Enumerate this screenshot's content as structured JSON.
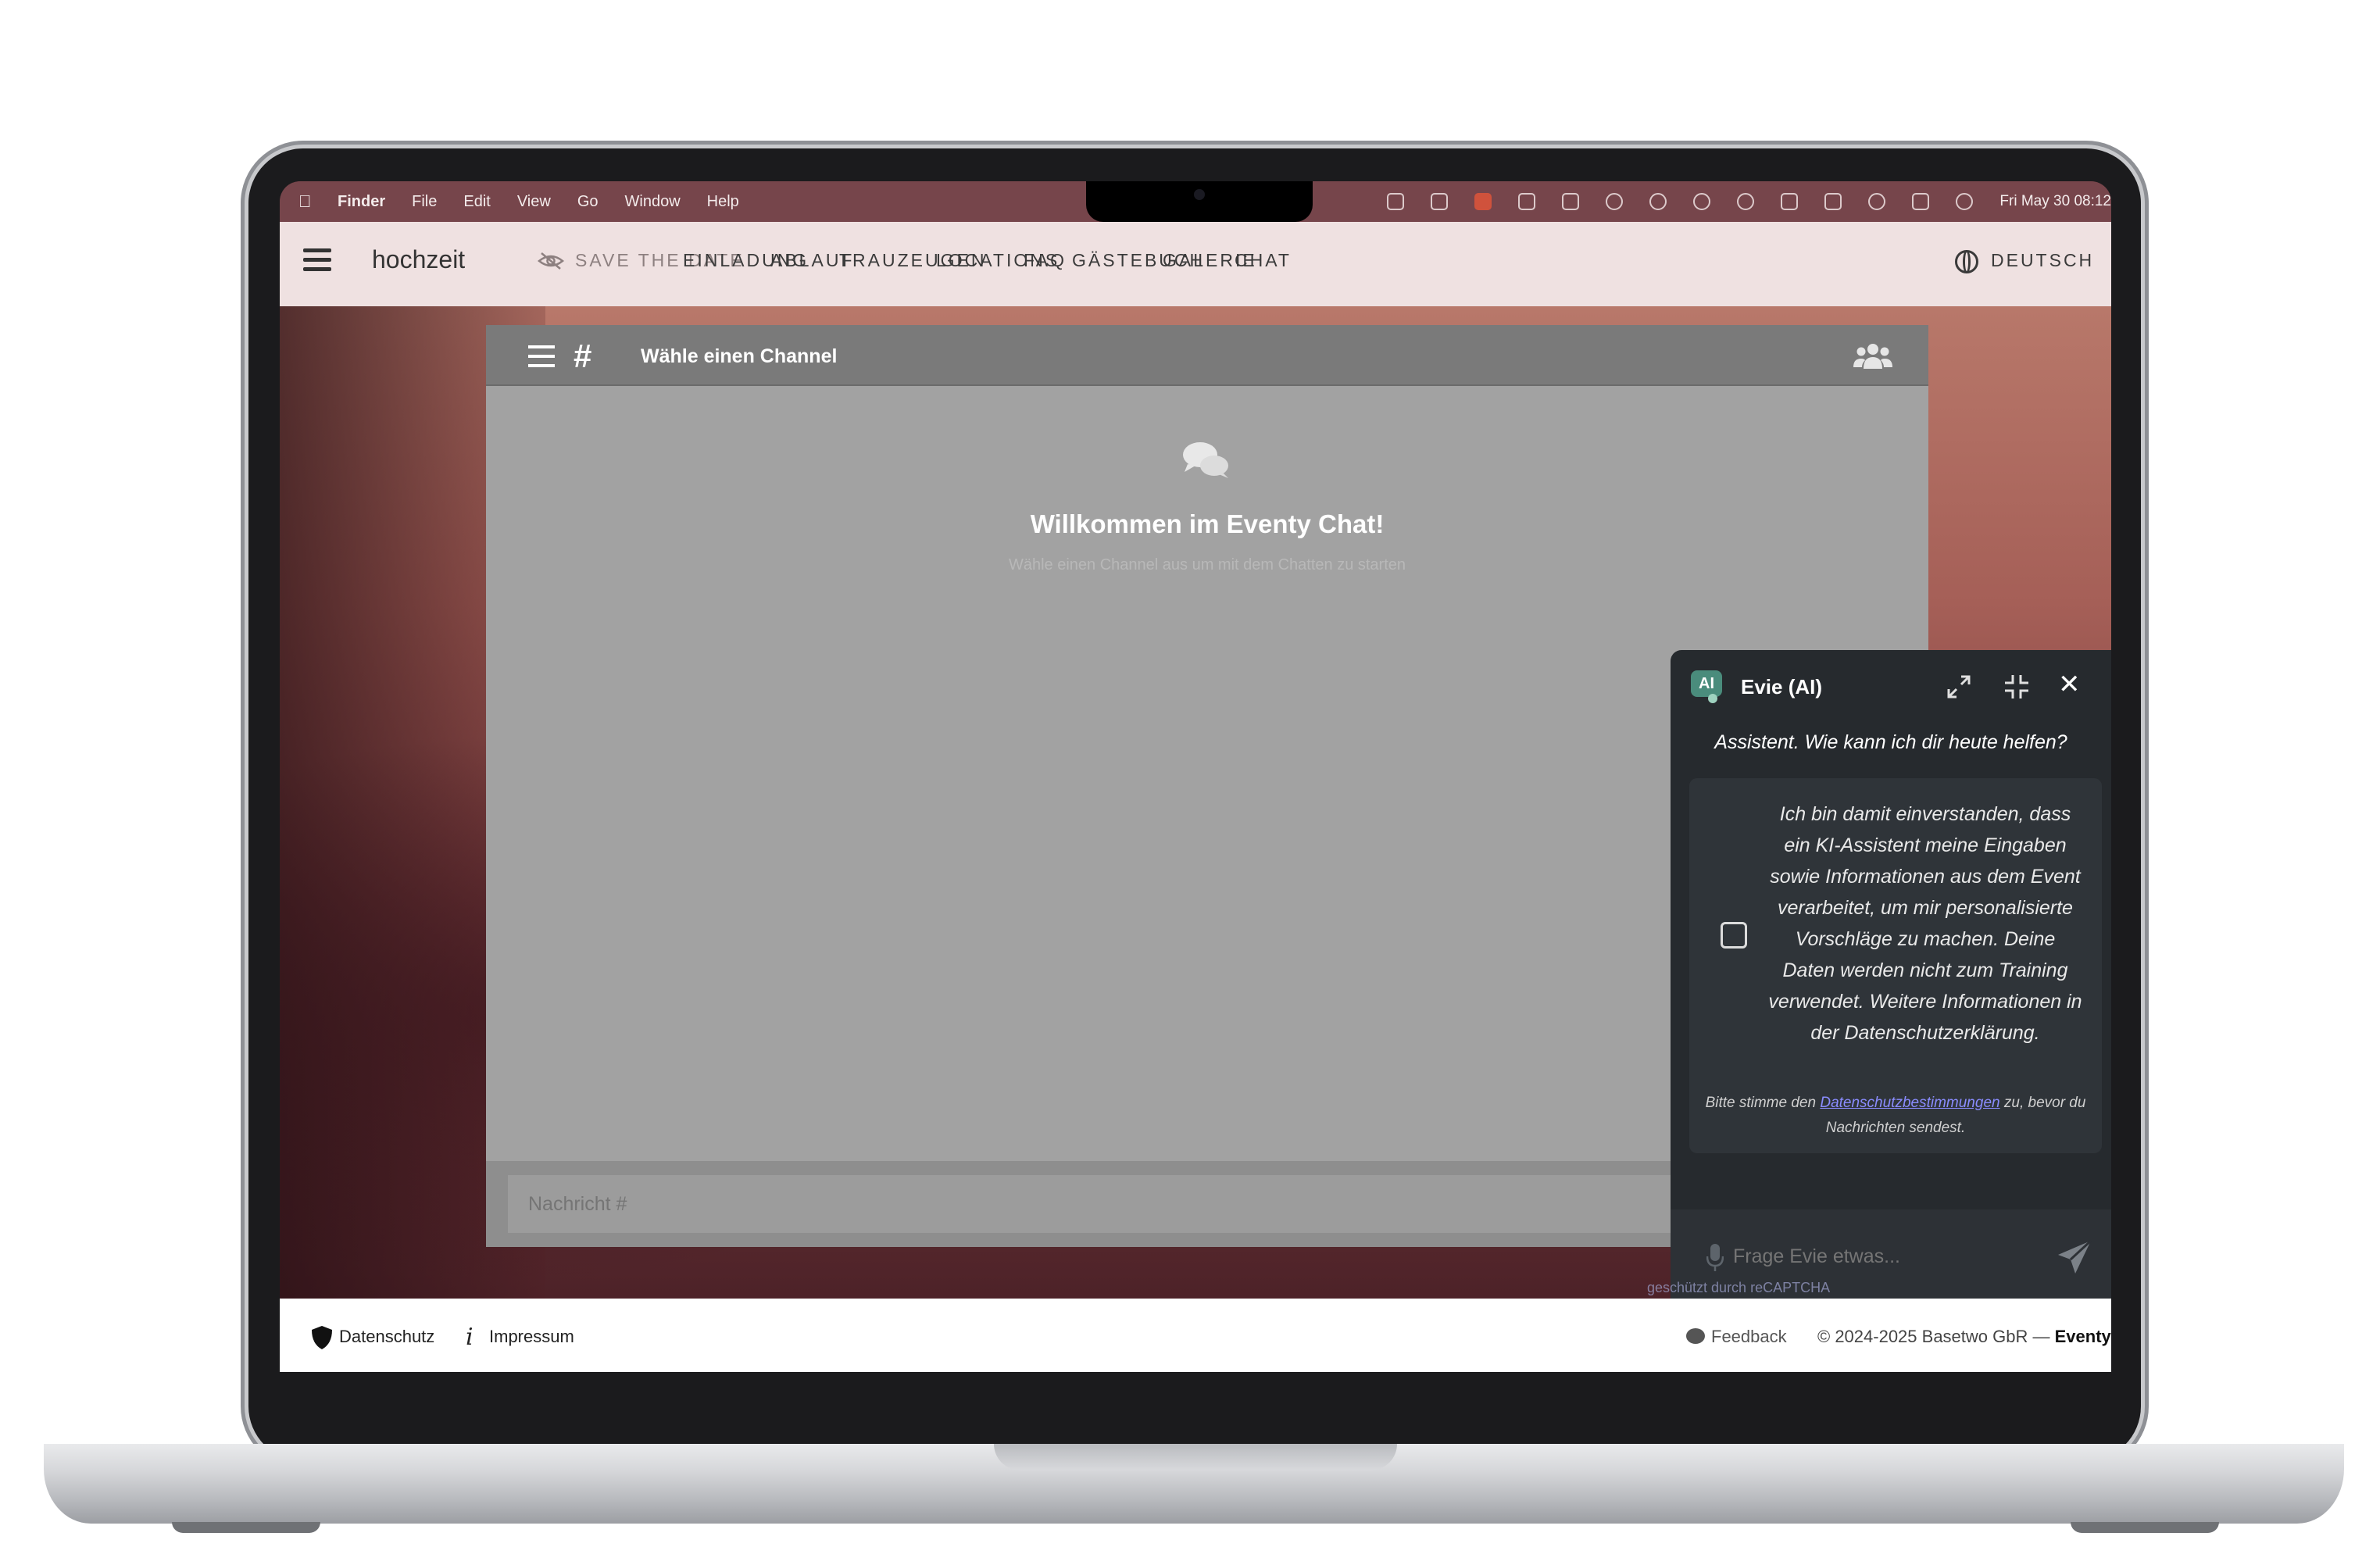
{
  "menubar": {
    "app": "Finder",
    "items": [
      "File",
      "Edit",
      "View",
      "Go",
      "Window",
      "Help"
    ],
    "clock": "Fri May 30  08:12"
  },
  "site": {
    "brand": "hochzeit",
    "nav": [
      {
        "label": "SAVE THE DATE",
        "muted": true
      },
      {
        "label": "EINLADUNG"
      },
      {
        "label": "ABLAUF"
      },
      {
        "label": "TRAUZEUGEN"
      },
      {
        "label": "LOCATIONS"
      },
      {
        "label": "FAQ"
      },
      {
        "label": "GÄSTEBUCH"
      },
      {
        "label": "GALERIE"
      },
      {
        "label": "CHAT"
      }
    ],
    "language": "DEUTSCH"
  },
  "chat": {
    "channel_title": "Wähle einen Channel",
    "welcome_title": "Willkommen im Eventy Chat!",
    "welcome_sub": "Wähle einen Channel aus um mit dem Chatten zu starten",
    "input_placeholder": "Nachricht #"
  },
  "ai": {
    "badge": "AI",
    "title": "Evie (AI)",
    "greeting": "Assistent. Wie kann ich dir heute helfen?",
    "consent_text": "Ich bin damit einverstanden, dass ein KI-Assistent meine Eingaben sowie Informationen aus dem Event verarbeitet, um mir personalisierte Vorschläge zu machen. Deine Daten werden nicht zum Training verwendet. Weitere Informationen in der Datenschutzerklärung.",
    "note_before": "Bitte stimme den ",
    "note_link": "Datenschutzbestimmungen",
    "note_after": " zu, bevor du Nachrichten sendest.",
    "input_placeholder": "Frage Evie etwas...",
    "recaptcha": "geschützt durch reCAPTCHA"
  },
  "footer": {
    "privacy": "Datenschutz",
    "imprint": "Impressum",
    "feedback": "Feedback",
    "copyright": "© 2024-2025 Basetwo GbR — ",
    "copyright_brand": "Eventy"
  },
  "colors": {
    "nav_bg": "#f6e9e9",
    "chat_bg": "#a2a2a2",
    "ai_bg": "#262a2e",
    "link": "#8a8cff"
  }
}
